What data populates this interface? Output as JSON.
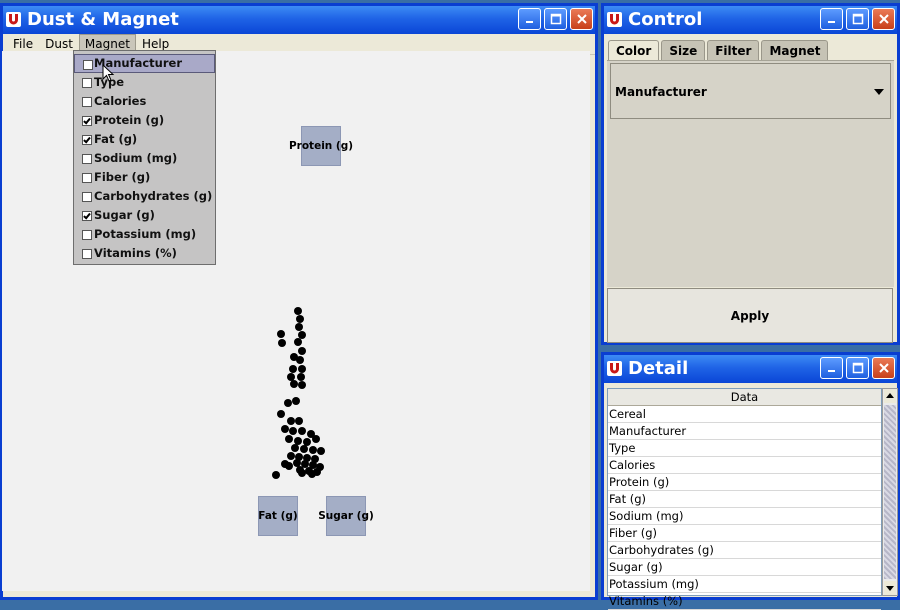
{
  "main": {
    "title": "Dust & Magnet",
    "menus": [
      "File",
      "Dust",
      "Magnet",
      "Help"
    ],
    "magnet_menu": [
      {
        "label": "Manufacturer",
        "checked": false,
        "highlighted": true
      },
      {
        "label": "Type",
        "checked": false
      },
      {
        "label": "Calories",
        "checked": false
      },
      {
        "label": "Protein (g)",
        "checked": true
      },
      {
        "label": "Fat (g)",
        "checked": true
      },
      {
        "label": "Sodium (mg)",
        "checked": false
      },
      {
        "label": "Fiber (g)",
        "checked": false
      },
      {
        "label": "Carbohydrates (g)",
        "checked": false
      },
      {
        "label": "Sugar (g)",
        "checked": true
      },
      {
        "label": "Potassium (mg)",
        "checked": false
      },
      {
        "label": "Vitamins (%)",
        "checked": false
      }
    ],
    "magnets": [
      "Protein (g)",
      "Fat (g)",
      "Sugar (g)"
    ]
  },
  "control": {
    "title": "Control",
    "tabs": [
      "Color",
      "Size",
      "Filter",
      "Magnet"
    ],
    "selected_tab": "Color",
    "color_select": "Manufacturer",
    "apply_label": "Apply"
  },
  "detail": {
    "title": "Detail",
    "column_header": "Data",
    "rows": [
      "Cereal",
      "Manufacturer",
      "Type",
      "Calories",
      "Protein (g)",
      "Fat (g)",
      "Sodium (mg)",
      "Fiber (g)",
      "Carbohydrates (g)",
      "Sugar (g)",
      "Potassium (mg)",
      "Vitamins (%)"
    ]
  },
  "icons": {
    "app": "magnet-icon",
    "minimize": "minimize-icon",
    "maximize": "maximize-icon",
    "close": "close-icon",
    "cursor": "cursor-arrow-icon"
  },
  "colors": {
    "titlebar": "#0a46d6",
    "magnet": "#a4aec6",
    "dust": "#000000"
  }
}
